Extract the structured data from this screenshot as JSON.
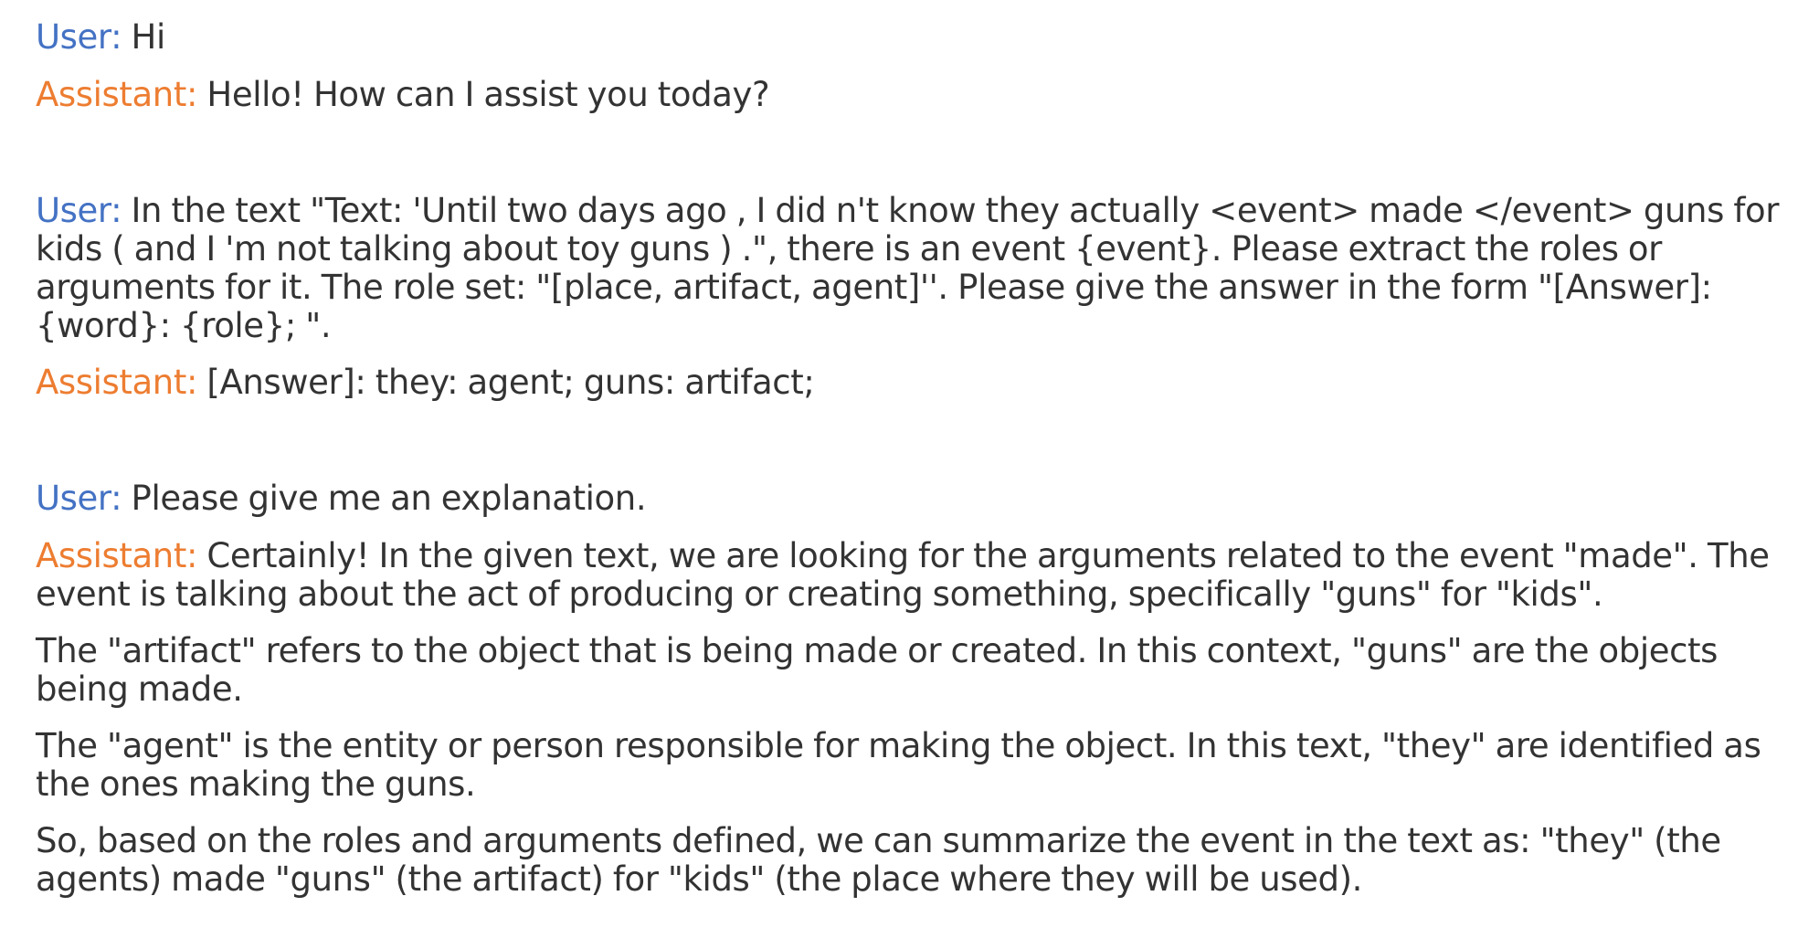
{
  "colors": {
    "user_speaker": "#4472c4",
    "assistant_speaker": "#ed7d31",
    "body_text": "#333333"
  },
  "conversation": [
    {
      "speaker": "User:",
      "text": "Hi"
    },
    {
      "speaker": "Assistant:",
      "text": "Hello! How can I assist you today?"
    },
    {
      "speaker": "User:",
      "text": "In the text \"Text: 'Until two days ago , I did n't know they actually <event> made </event> guns for kids ( and I 'm not talking about toy guns ) .\", there is an event {event}. Please extract the roles or arguments for it. The role set: \"[place, artifact, agent]''. Please give the answer in the form \"[Answer]: {word}: {role}; \"."
    },
    {
      "speaker": "Assistant:",
      "text": "[Answer]: they: agent; guns: artifact;"
    },
    {
      "speaker": "User:",
      "text": "Please give me an explanation."
    },
    {
      "speaker": "Assistant:",
      "text": "Certainly! In the given text, we are looking for the arguments related to the event \"made\". The event is talking about the act of producing or creating something, specifically \"guns\" for \"kids\".",
      "paragraphs": [
        "The \"artifact\" refers to the object that is being made or created. In this context, \"guns\" are the objects being made.",
        "The \"agent\" is the entity or person responsible for making the object. In this text, \"they\" are identified as the ones making the guns.",
        "So, based on the roles and arguments defined, we can summarize the event in the text as: \"they\" (the agents) made \"guns\" (the artifact) for \"kids\" (the place where they will be used)."
      ]
    }
  ]
}
